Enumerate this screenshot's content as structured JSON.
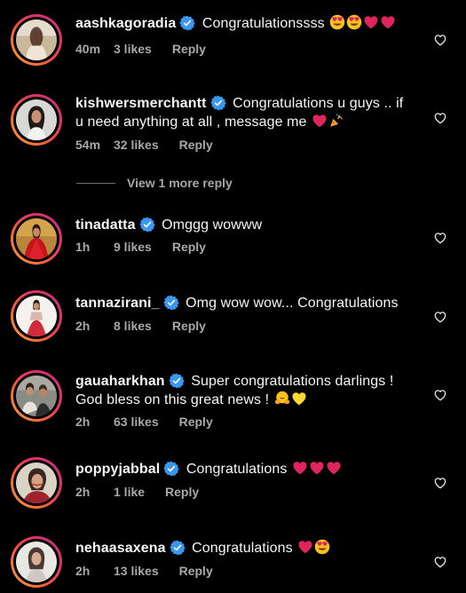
{
  "comments": [
    {
      "username": "aashkagoradia",
      "text": "Congratulationssss",
      "emojis": [
        "heart-eyes",
        "heart-eyes",
        "red-heart",
        "red-heart"
      ],
      "time": "40m",
      "likes": "3 likes",
      "reply": "Reply"
    },
    {
      "username": "kishwersmerchantt",
      "text": "Congratulations u guys .. if u need anything at all , message me",
      "emojis": [
        "red-heart",
        "party-popper"
      ],
      "time": "54m",
      "likes": "32 likes",
      "reply": "Reply"
    },
    {
      "username": "tinadatta",
      "text": "Omggg wowww",
      "emojis": [],
      "time": "1h",
      "likes": "9 likes",
      "reply": "Reply"
    },
    {
      "username": "tannazirani_",
      "text": "Omg wow wow... Congratulations",
      "emojis": [],
      "time": "2h",
      "likes": "8 likes",
      "reply": "Reply"
    },
    {
      "username": "gauaharkhan",
      "text": "Super congratulations darlings ! God bless on this great news !",
      "emojis": [
        "hugging-face",
        "yellow-heart"
      ],
      "time": "2h",
      "likes": "63 likes",
      "reply": "Reply"
    },
    {
      "username": "poppyjabbal",
      "text": "Congratulations",
      "emojis": [
        "red-heart",
        "red-heart",
        "red-heart"
      ],
      "time": "2h",
      "likes": "1 like",
      "reply": "Reply"
    },
    {
      "username": "nehaasaxena",
      "text": "Congratulations",
      "emojis": [
        "red-heart",
        "heart-eyes"
      ],
      "time": "2h",
      "likes": "13 likes",
      "reply": "Reply"
    }
  ],
  "view_more_replies": "View 1 more reply",
  "icons": {
    "verified": "verified-badge-icon",
    "like": "heart-outline-icon"
  },
  "colors": {
    "background": "#000000",
    "text": "#f5f5f5",
    "secondary": "#a8a8a8",
    "verified": "#3897f0",
    "heart_emoji": "#e0245e"
  }
}
